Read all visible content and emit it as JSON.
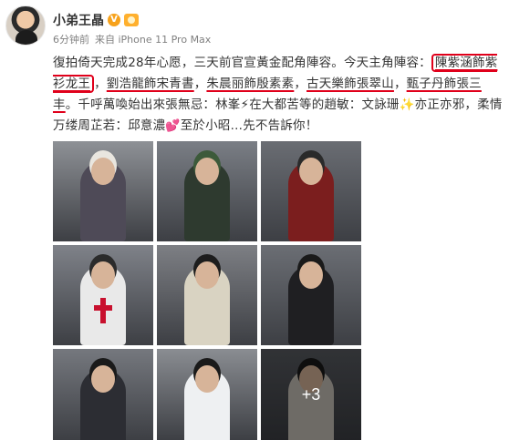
{
  "post": {
    "user_name": "小弟王晶",
    "verified_badge": "V",
    "time": "6分钟前",
    "source": "来自 iPhone 11 Pro Max",
    "text": {
      "part1": "復拍倚天完成28年心愿，三天前官宣黃金配角陣容。今天主角陣容：",
      "hl1": "陳紫涵飾紫衫龙王",
      "sep1": "，",
      "hl2": "劉浩龍飾宋青書",
      "sep2": "，",
      "hl3": "朱晨丽飾殷素素",
      "sep3": "，",
      "hl4": "古天樂飾張翠山",
      "sep4": "，",
      "hl5": "甄子丹飾張三丰",
      "part2": "。千呼萬喚始出來張無忌：林峯",
      "spark1": "⚡",
      "part3": "在大都苦等的趙敏：文詠珊",
      "spark2": "✨",
      "part4": "亦正亦邪，柔情万缕周芷若：邱意濃",
      "heart": "💕",
      "part5": "至於小昭…先不告訴你！"
    },
    "images": [
      {
        "id": 1,
        "desc": "old-man-white-hair",
        "bg": "#8e9196",
        "robe": "#4e4a57",
        "hair": "#e9e6df"
      },
      {
        "id": 2,
        "desc": "green-hair-horns",
        "bg": "#7a7e85",
        "robe": "#2e3a2f",
        "hair": "#3c5a3a"
      },
      {
        "id": 3,
        "desc": "red-robe-man",
        "bg": "#6a6d73",
        "robe": "#7b1e1e",
        "hair": "#2a2a2a"
      },
      {
        "id": 4,
        "desc": "red-cross-monk",
        "bg": "#7f8289",
        "robe": "#e9e9e9",
        "hair": "#2b2b2b"
      },
      {
        "id": 5,
        "desc": "white-robe-youth",
        "bg": "#7d7f84",
        "robe": "#d9d3c2",
        "hair": "#1d1d1d"
      },
      {
        "id": 6,
        "desc": "black-robe-swordsman",
        "bg": "#6b6e74",
        "robe": "#1f1f22",
        "hair": "#1a1a1a"
      },
      {
        "id": 7,
        "desc": "dark-robe-woman",
        "bg": "#75787e",
        "robe": "#2c2d33",
        "hair": "#1a1a1a"
      },
      {
        "id": 8,
        "desc": "fur-collar-woman",
        "bg": "#8a8d92",
        "robe": "#eef0f2",
        "hair": "#1a1a1a"
      },
      {
        "id": 9,
        "desc": "white-robe-woman",
        "bg": "#5a5d63",
        "robe": "#c9c4bb",
        "hair": "#1b1b1b",
        "more": "+3"
      }
    ]
  },
  "colors": {
    "underline": "#e0001b",
    "meta": "#808080"
  }
}
